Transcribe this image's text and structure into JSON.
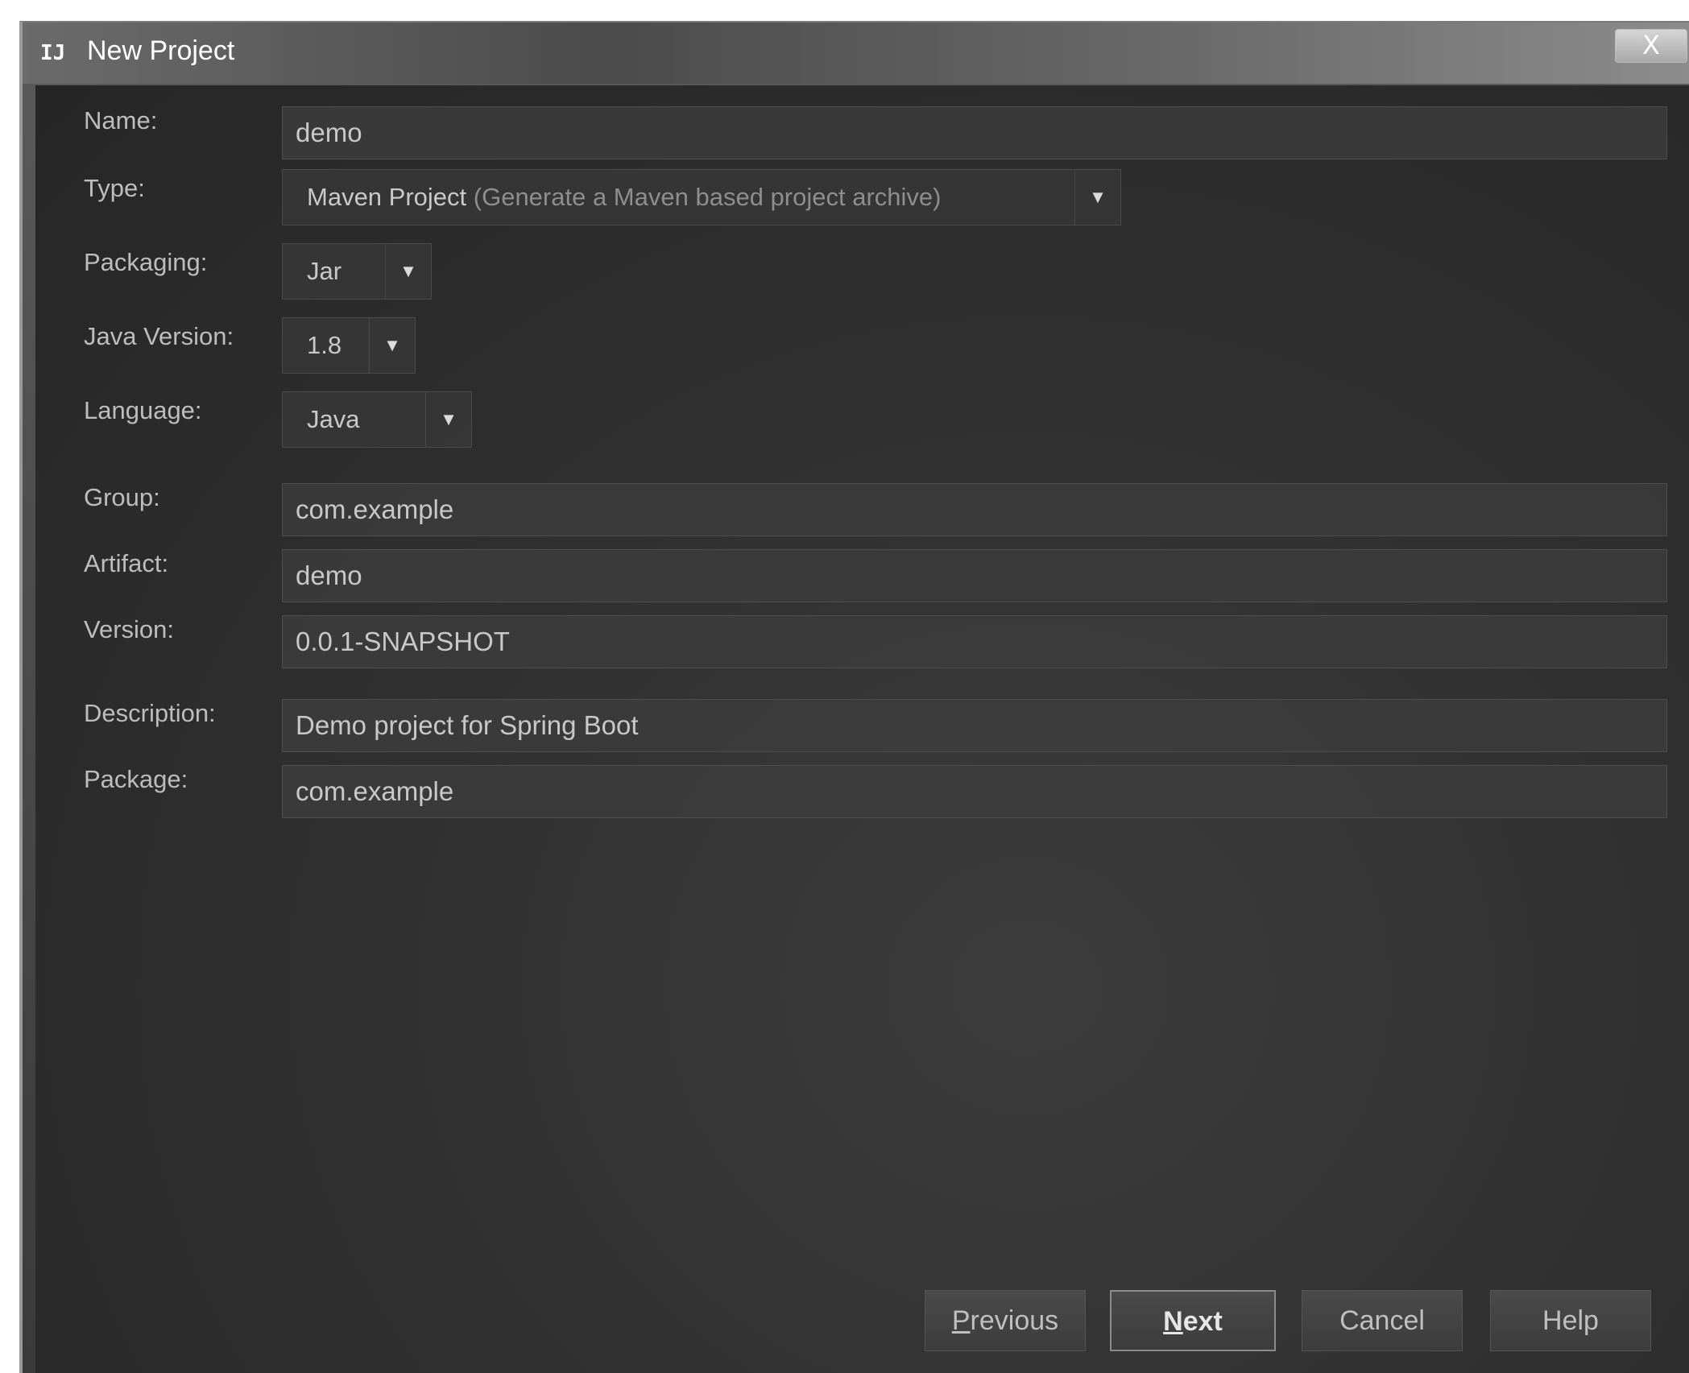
{
  "window": {
    "title": "New Project",
    "close_glyph": "X"
  },
  "form": {
    "name": {
      "label": "Name:",
      "value": "demo"
    },
    "type": {
      "label": "Type:",
      "value": "Maven Project",
      "hint": "(Generate a Maven based project archive)"
    },
    "packaging": {
      "label": "Packaging:",
      "value": "Jar"
    },
    "java_version": {
      "label": "Java Version:",
      "value": "1.8"
    },
    "language": {
      "label": "Language:",
      "value": "Java"
    },
    "group": {
      "label": "Group:",
      "value": "com.example"
    },
    "artifact": {
      "label": "Artifact:",
      "value": "demo"
    },
    "version": {
      "label": "Version:",
      "value": "0.0.1-SNAPSHOT"
    },
    "description": {
      "label": "Description:",
      "value": "Demo project for Spring Boot"
    },
    "package": {
      "label": "Package:",
      "value": "com.example"
    }
  },
  "buttons": {
    "previous": {
      "mnemonic": "P",
      "rest": "revious"
    },
    "next": {
      "mnemonic": "N",
      "rest": "ext"
    },
    "cancel": "Cancel",
    "help": "Help"
  },
  "icons": {
    "dropdown": "▼",
    "app": "IJ"
  }
}
